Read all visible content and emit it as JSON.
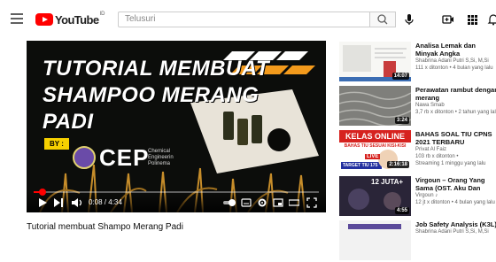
{
  "header": {
    "logo_text": "YouTube",
    "logo_region": "ID",
    "search_placeholder": "Telusuri",
    "icons": [
      "menu-icon",
      "search-icon",
      "mic-icon",
      "create-video-icon",
      "apps-grid-icon",
      "notifications-bell-icon"
    ]
  },
  "player": {
    "title_lines": [
      "TUTORIAL MEMBUAT",
      "SHAMPOO MERANG",
      "PADI"
    ],
    "by_label": "BY :",
    "brand": "CEP",
    "brand_sub": "Chemical Engineerin Polinema",
    "time": "0:08 / 4:34",
    "progress": 0.03
  },
  "video": {
    "title": "Tutorial membuat Shampo Merang Padi"
  },
  "sidebar": {
    "items": [
      {
        "title": "Analisa Lemak dan Minyak Angka Penyabunan dan...",
        "channel": "Shabrina Adani Putri S,Si, M,Si",
        "stats": "111 x ditonton • 4 bulan yang lalu",
        "duration": "14:07"
      },
      {
        "title": "Perawatan rambut dengan merang",
        "channel": "Nawa Smab",
        "stats": "3,7 rb x ditonton • 2 tahun yang lalu",
        "duration": "3:24"
      },
      {
        "title": "BAHAS SOAL TIU CPNS 2021 TERBARU",
        "channel": "Privat Al Faiz",
        "stats": "103 rb x ditonton •",
        "stats2": "Streaming 1 minggu yang lalu",
        "duration": "2:16:18",
        "thumb_text": "KELAS ONLINE",
        "thumb_sub": "BAHAS TIU SESUAI KISI-KISI",
        "thumb_text2": "TARGET TIU 175",
        "thumb_badge": "LIVE"
      },
      {
        "title": "Virgoun – Orang Yang Sama (OST. Aku Dan Mesin Waktu)",
        "channel": "Virgoun ♪",
        "stats": "12 jt x ditonton • 4 bulan yang lalu",
        "duration": "4:55",
        "thumb_text": "12 JUTA+"
      },
      {
        "title": "Job Safety Analysis (K3L)",
        "channel": "Shabrina Adani Putri S,Si, M,Si",
        "stats": "",
        "duration": ""
      }
    ]
  }
}
